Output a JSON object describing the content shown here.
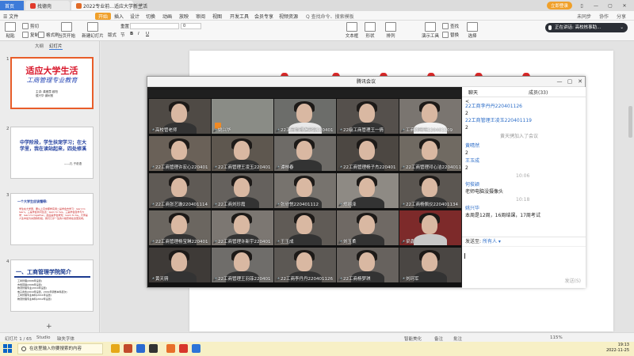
{
  "titlebar": {
    "home_tab": "首页",
    "wps_tab": "找德壳",
    "doc_tab": "2022专业前...适应大学新生活",
    "add_tab": "+",
    "login": "立即登录",
    "controls": [
      "▯",
      "—",
      "▢",
      "✕"
    ]
  },
  "menubar": {
    "file": "☰ 文件",
    "start": "开始",
    "items": [
      "插入",
      "设计",
      "切换",
      "动画",
      "放映",
      "审阅",
      "视图",
      "开发工具",
      "会员专享",
      "视频资源"
    ],
    "search": "Q 查找命令、搜索模板",
    "right": [
      "未同步",
      "协作",
      "分享"
    ]
  },
  "ribbon": {
    "paste": "粘贴",
    "cut": "剪切",
    "copy": "复制",
    "format": "格式刷",
    "from_current": "当页开始",
    "new_slide": "新建幻灯片",
    "layout": "版式",
    "section": "节",
    "reset": "重置",
    "font_name": "",
    "font_size": "0",
    "bold": "B",
    "italic": "I",
    "underline": "U",
    "text_box": "文本框",
    "shapes": "形状",
    "arrange": "排列",
    "quick_style": "演示工具",
    "replace": "替换",
    "find": "查找",
    "select": "选择",
    "smart_art": "转换成图示"
  },
  "live": {
    "text": "正在讲话: 高校核事助..."
  },
  "leftpane": {
    "tab_outline": "大纲",
    "tab_slides": "幻灯片",
    "slides": [
      {
        "num": "1",
        "title": "适应大学生活",
        "subtitle": "工商管理专业教育",
        "meta": "主讲: 龚爱霞 欧阳\n侯兴华 谢树宽"
      },
      {
        "num": "2",
        "text": "中学阶段，学生扶宠学习；在大学里，我在读站起来，四处修溪",
        "sig": "——孔 子说语"
      },
      {
        "num": "3",
        "head": "一个大学生应该懂得:",
        "body": "学生在大学里，要从上高中那样实用二是学会去学习：learn to learn。三是学会共同生活：learn to live。三是学会自学与大学：learn to together。最后是学会求知：learn to be。大学是人生中最为关键的阶段，我们几乎一生的人格形成在这里完成。"
      },
      {
        "num": "4",
        "title": "一、工商管理学院简介",
        "body": "工商管理(2006年设置)\n市场营销(2006年设置)\n物流管理专业(2010年设置)\n电子商务(2010年设置，2019年调整本科层次)\n工商管理专业本科(2011年设置)\n物流管理专业本科(2012年设置)"
      }
    ],
    "add": "+"
  },
  "meeting": {
    "title": "腾讯会议",
    "controls": [
      "—",
      "▢",
      "✕"
    ],
    "participants": [
      "高校管老师",
      "姚兴华",
      "22工商管理谯新铭220401",
      "22级工商管理王一倩",
      "工商刘晴晴220401109",
      "22工商管理许宏心220401",
      "22工商管理王凌玉220401",
      "谭林春",
      "22工商管理杨子杰220401",
      "22工商管理邓心洁220401106",
      "22工商张艺璇220401114",
      "22工商刘珍霞",
      "张欣悦220401112",
      "郑翊泽",
      "22工商杨佩仪220401134",
      "22工商管理杨宝琳220401",
      "22工商管理许新宇220401",
      "王玉成",
      "刘玉柔",
      "梁鑫",
      "黄天骋",
      "22工商管理王羽菲220401",
      "22工商李丹丹220401126",
      "22工商杨梦琪",
      "刘珂军"
    ],
    "tab_chat": "聊天",
    "tab_members": "成员(33)",
    "chat": [
      {
        "kind": "text",
        "value": "<"
      },
      {
        "kind": "name",
        "value": "22工商李丹丹220401126"
      },
      {
        "kind": "text",
        "value": "2"
      },
      {
        "kind": "name",
        "value": "22工商管理王凌玉220401119"
      },
      {
        "kind": "text",
        "value": "2"
      },
      {
        "kind": "sys",
        "value": "黄天骋加入了会议"
      },
      {
        "kind": "name",
        "value": "黄晴然"
      },
      {
        "kind": "text",
        "value": "2"
      },
      {
        "kind": "name",
        "value": "王玉成"
      },
      {
        "kind": "text",
        "value": "2"
      },
      {
        "kind": "time",
        "value": "10:06"
      },
      {
        "kind": "name",
        "value": "何俊颖"
      },
      {
        "kind": "text",
        "value": "老师电脑没摄像头"
      },
      {
        "kind": "time",
        "value": "10:18"
      },
      {
        "kind": "name",
        "value": "姚兴华"
      },
      {
        "kind": "text",
        "value": "本周是12周，16周结课，17周考试"
      }
    ],
    "send_to_label": "发送至:",
    "send_to_value": "所有人 ▾",
    "send_button": "发送(S)"
  },
  "statusbar": {
    "slide_info": "幻灯片 1 / 65",
    "theme": "Studio",
    "missing_font": "缺失字体",
    "notes": "智能美化",
    "remarks": "备注",
    "comments": "批注",
    "zoom": "115%"
  },
  "taskbar": {
    "search": "在这里输入你要搜索的内容",
    "time": "19:13",
    "date": "2022-11-25"
  },
  "colors": {
    "accent_blue": "#3d7bd9",
    "wps_orange": "#f0a02a",
    "slide_red": "#d8162a"
  }
}
